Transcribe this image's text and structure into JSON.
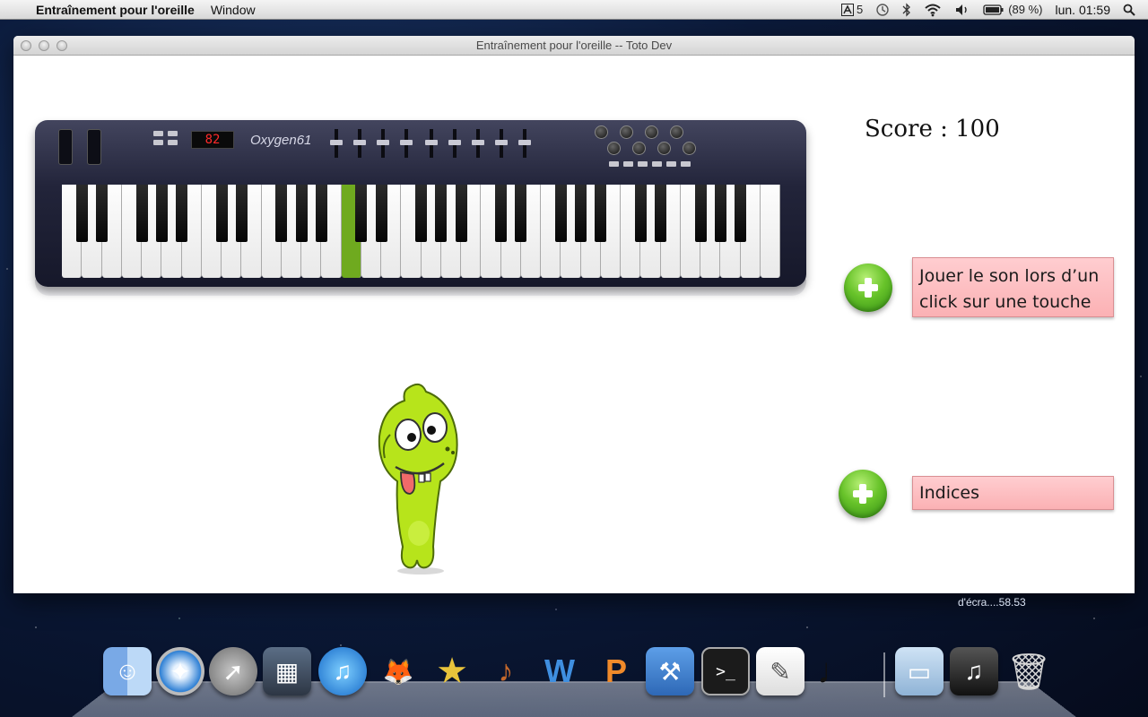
{
  "menubar": {
    "apple_glyph": "",
    "app_name": "Entraînement pour l'oreille",
    "menus": [
      "Window"
    ],
    "status": {
      "adobe_badge": "5",
      "battery": "(89 %)",
      "clock": "lun. 01:59"
    }
  },
  "window": {
    "title": "Entraînement pour l'oreille -- Toto Dev"
  },
  "keyboard": {
    "display": "82",
    "brand": "Oxygen61",
    "white_keys": 36,
    "highlighted_white_key": 14
  },
  "score": {
    "text": "Score : 100"
  },
  "options": [
    {
      "label": "Jouer le son lors d’un click sur une touche"
    },
    {
      "label": "Indices"
    }
  ],
  "desktop": {
    "file_label": "d'écra....58.53"
  },
  "dock": {
    "items": [
      "finder-icon",
      "safari-icon",
      "launchpad-icon",
      "photo-browser-icon",
      "itunes-icon",
      "gimp-icon",
      "imovie-icon",
      "garageband-icon",
      "word-icon",
      "powerpoint-icon",
      "xcode-icon",
      "terminal-icon",
      "textedit-icon",
      "music-note-icon",
      "downloads-folder-icon",
      "music-stack-icon",
      "trash-icon"
    ]
  },
  "colors": {
    "highlight_key": "#6faa1f",
    "option_bg": "#fbb1b4",
    "plus_green": "#68c32a",
    "mascot_green": "#b7e41b"
  }
}
